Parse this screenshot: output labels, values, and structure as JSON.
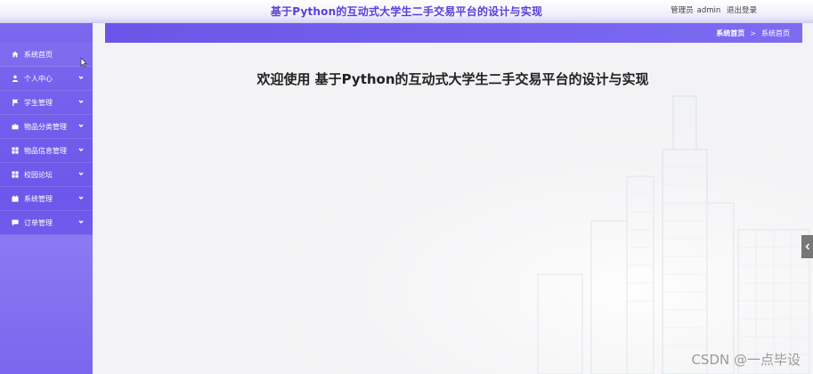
{
  "header": {
    "title": "基于Python的互动式大学生二手交易平台的设计与实现",
    "role_label": "管理员",
    "username": "admin",
    "logout_label": "退出登录"
  },
  "sidebar": {
    "items": [
      {
        "label": "系统首页",
        "icon": "home-icon",
        "has_submenu": false
      },
      {
        "label": "个人中心",
        "icon": "user-icon",
        "has_submenu": true
      },
      {
        "label": "学生管理",
        "icon": "flag-icon",
        "has_submenu": true
      },
      {
        "label": "物品分类管理",
        "icon": "briefcase-icon",
        "has_submenu": true
      },
      {
        "label": "物品信息管理",
        "icon": "grid-icon",
        "has_submenu": true
      },
      {
        "label": "校园论坛",
        "icon": "grid-icon",
        "has_submenu": true
      },
      {
        "label": "系统管理",
        "icon": "calendar-icon",
        "has_submenu": true
      },
      {
        "label": "订单管理",
        "icon": "chat-icon",
        "has_submenu": true
      }
    ]
  },
  "breadcrumb": {
    "home": "系统首页",
    "separator": ">",
    "current": "系统首页"
  },
  "main": {
    "welcome": "欢迎使用 基于Python的互动式大学生二手交易平台的设计与实现"
  },
  "watermark": "CSDN @一点毕设",
  "colors": {
    "accent": "#6b57ea",
    "title": "#5a3fd8",
    "sidebar": "#7a68ef"
  }
}
